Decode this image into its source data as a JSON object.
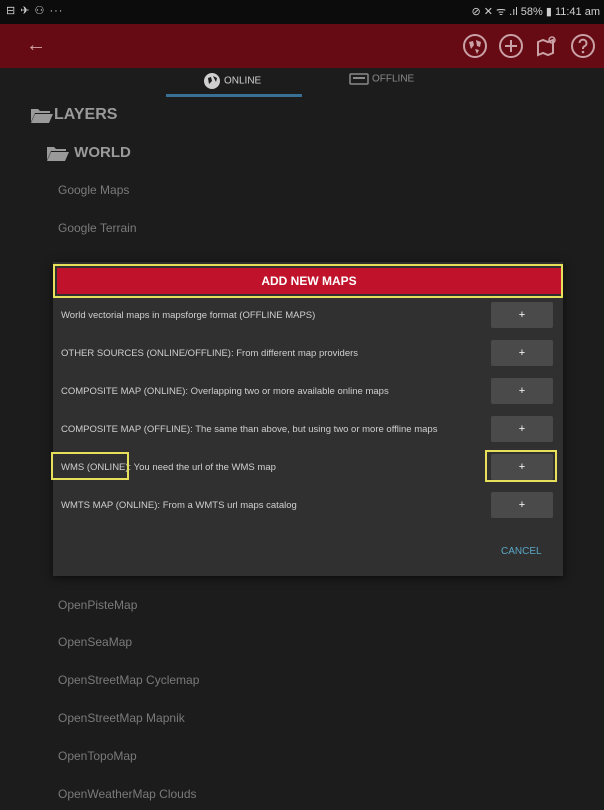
{
  "status_bar": {
    "left": "⊟ ✈ ⚇ ···",
    "right": "⊘ ✕ ᯤ .ıl 58% ▮ 11:41 am"
  },
  "tabs": [
    {
      "label": "ONLINE"
    },
    {
      "label": "OFFLINE"
    }
  ],
  "tree": {
    "layers_label": "LAYERS",
    "world_label": "WORLD"
  },
  "maps_top": [
    "Google Maps",
    "Google Terrain"
  ],
  "dialog": {
    "title": "ADD NEW MAPS",
    "options": [
      {
        "label": "World vectorial maps in mapsforge format (OFFLINE MAPS)",
        "button": "+"
      },
      {
        "label": "OTHER SOURCES (ONLINE/OFFLINE): From different map providers",
        "button": "+"
      },
      {
        "label": "COMPOSITE MAP (ONLINE): Overlapping two or more available online maps",
        "button": "+"
      },
      {
        "label": "COMPOSITE MAP (OFFLINE): The same than above, but using two or more offline maps",
        "button": "+"
      },
      {
        "label": "WMS (ONLINE): You need the url of the WMS map",
        "button": "+"
      },
      {
        "label": "WMTS MAP (ONLINE): From a WMTS url maps catalog",
        "button": "+"
      }
    ],
    "cancel": "CANCEL"
  },
  "maps_bottom": [
    "OpenPisteMap",
    "OpenSeaMap",
    "OpenStreetMap Cyclemap",
    "OpenStreetMap Mapnik",
    "OpenTopoMap",
    "OpenWeatherMap Clouds"
  ],
  "colors": {
    "appbar": "#660b14",
    "dialog_title": "#c0132b",
    "highlight": "#e8e05a",
    "accent": "#3a6f95"
  }
}
